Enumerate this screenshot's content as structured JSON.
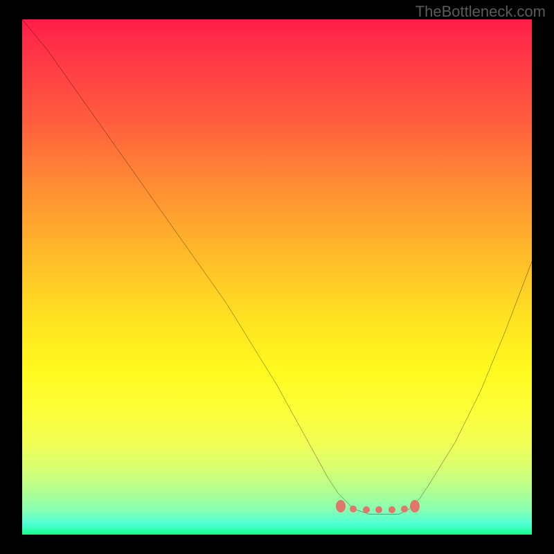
{
  "branding": {
    "watermark": "TheBottleneck.com"
  },
  "chart_data": {
    "type": "line",
    "title": "",
    "xlabel": "",
    "ylabel": "",
    "xlim": [
      0,
      100
    ],
    "ylim": [
      0,
      100
    ],
    "grid": false,
    "legend": false,
    "x": [
      0,
      5,
      10,
      15,
      20,
      25,
      30,
      35,
      40,
      45,
      50,
      55,
      60,
      62,
      65,
      68,
      70,
      72,
      74,
      76,
      78,
      80,
      85,
      90,
      95,
      100
    ],
    "values": [
      100,
      94,
      87,
      80,
      73,
      66,
      59,
      52,
      45,
      37,
      29,
      20,
      11,
      8,
      5,
      4,
      4,
      4,
      4,
      5,
      7,
      10,
      18,
      28,
      40,
      53
    ],
    "markers": {
      "endpoints": [
        {
          "x": 62.5,
          "y": 5.5
        },
        {
          "x": 77.0,
          "y": 5.5
        }
      ],
      "dots": [
        {
          "x": 65.0,
          "y": 5.0
        },
        {
          "x": 67.5,
          "y": 4.8
        },
        {
          "x": 70.0,
          "y": 4.8
        },
        {
          "x": 72.5,
          "y": 4.8
        },
        {
          "x": 75.0,
          "y": 5.0
        }
      ]
    },
    "background_gradient": {
      "top": "#ff1b48",
      "mid": "#ffe024",
      "bottom": "#12ff8a"
    },
    "line_color": "#000000",
    "marker_color": "#e2766a"
  }
}
